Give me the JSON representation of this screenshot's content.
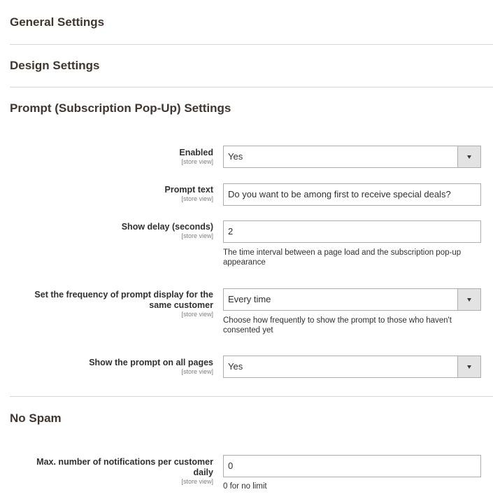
{
  "sections": {
    "general": "General Settings",
    "design": "Design Settings",
    "prompt": "Prompt (Subscription Pop-Up) Settings",
    "nospam": "No Spam"
  },
  "fields": {
    "enabled": {
      "label": "Enabled",
      "scope": "[store view]",
      "value": "Yes"
    },
    "prompt_text": {
      "label": "Prompt text",
      "scope": "[store view]",
      "value": "Do you want to be among first to receive special deals?"
    },
    "show_delay": {
      "label": "Show delay (seconds)",
      "scope": "[store view]",
      "value": "2",
      "note": "The time interval between a page load and the subscription pop-up appearance"
    },
    "frequency": {
      "label_line1": "Set the frequency of prompt display for the",
      "label_line2": "same customer",
      "scope": "[store view]",
      "value": "Every time",
      "note": "Choose how frequently to show the prompt to those who haven't consented yet"
    },
    "all_pages": {
      "label": "Show the prompt on all pages",
      "scope": "[store view]",
      "value": "Yes"
    },
    "max_notifications": {
      "label_line1": "Max. number of notifications per customer",
      "label_line2": "daily",
      "scope": "[store view]",
      "value": "0",
      "note": "0 for no limit"
    }
  }
}
